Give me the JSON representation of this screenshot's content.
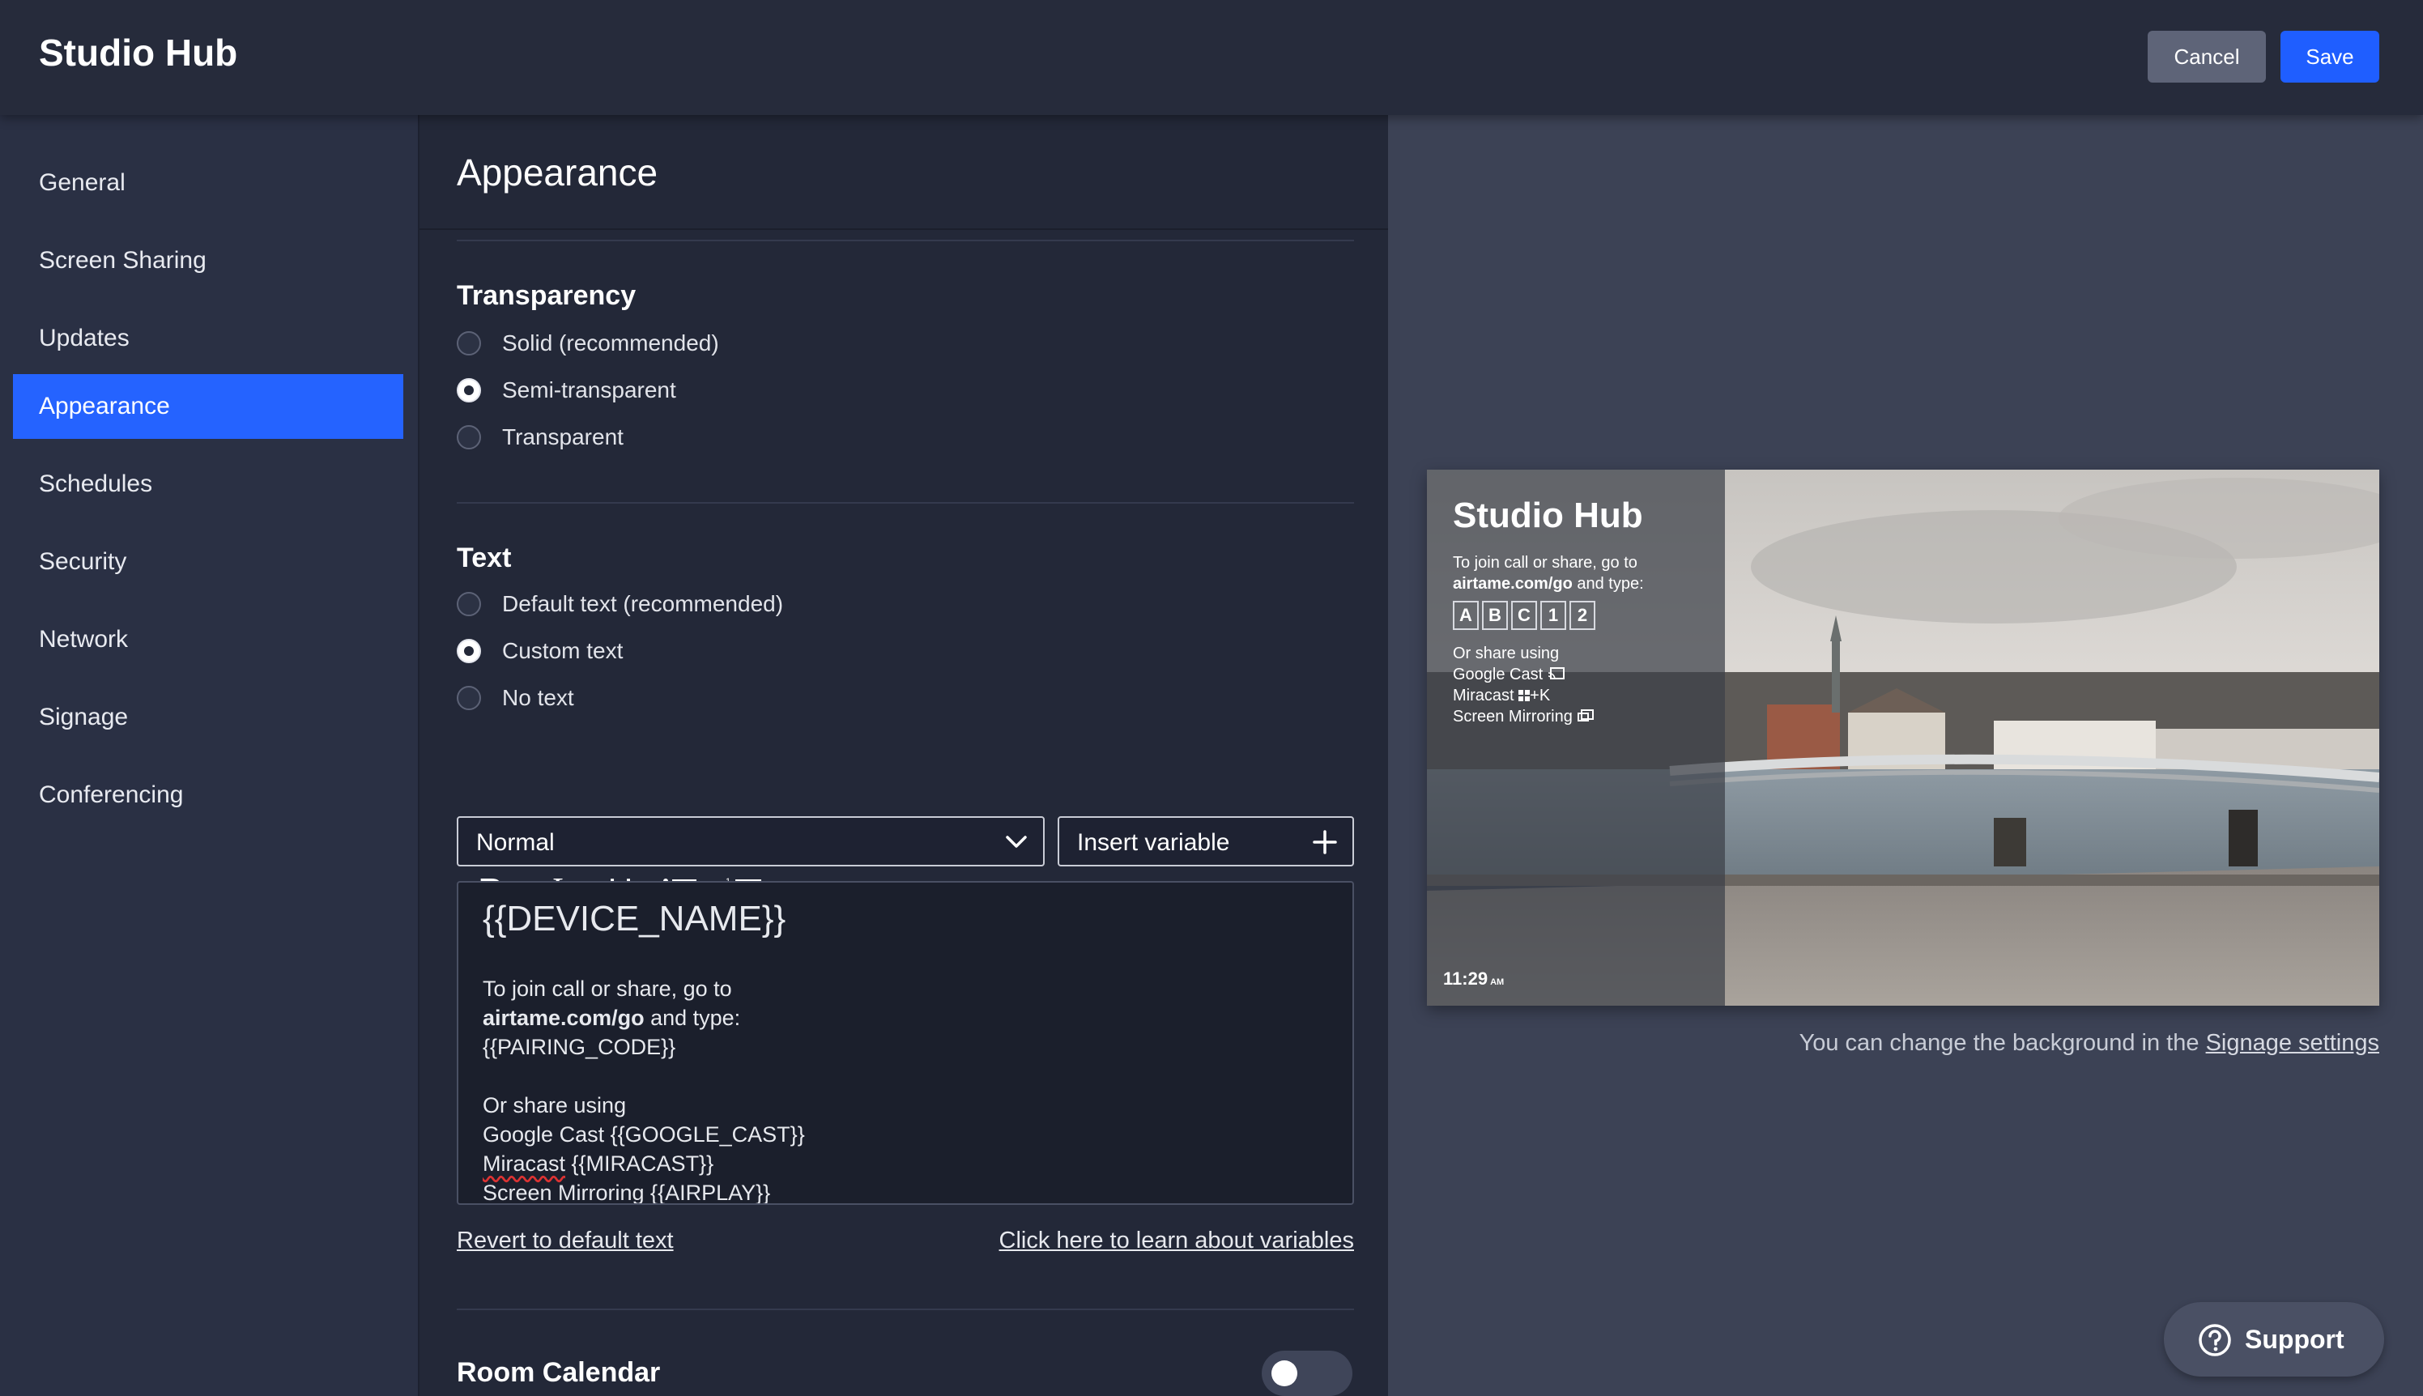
{
  "app": {
    "title": "Studio Hub"
  },
  "header": {
    "cancel_label": "Cancel",
    "save_label": "Save"
  },
  "sidebar": {
    "items": [
      {
        "label": "General"
      },
      {
        "label": "Screen Sharing"
      },
      {
        "label": "Updates"
      },
      {
        "label": "Appearance",
        "active": true
      },
      {
        "label": "Schedules"
      },
      {
        "label": "Security"
      },
      {
        "label": "Network"
      },
      {
        "label": "Signage"
      },
      {
        "label": "Conferencing"
      }
    ]
  },
  "panel": {
    "title": "Appearance",
    "transparency": {
      "title": "Transparency",
      "options": [
        "Solid (recommended)",
        "Semi-transparent",
        "Transparent"
      ],
      "selected": "Semi-transparent"
    },
    "text": {
      "title": "Text",
      "options": [
        "Default text (recommended)",
        "Custom text",
        "No text"
      ],
      "selected": "Custom text"
    },
    "editor": {
      "format_select": "Normal",
      "insert_variable_label": "Insert variable",
      "content": {
        "heading": "{{DEVICE_NAME}}",
        "line1": "To join call or share, go to",
        "line2_bold": "airtame.com/go",
        "line2_rest": " and type:",
        "line3": "{{PAIRING_CODE}}",
        "line4": "Or share using",
        "line5": "Google Cast {{GOOGLE_CAST}}",
        "line6_a": "Miracast",
        "line6_b": " {{MIRACAST}}",
        "line7": "Screen Mirroring {{AIRPLAY}}"
      }
    },
    "revert_link": "Revert to default text",
    "learn_link": "Click here to learn about variables",
    "room_calendar": {
      "title": "Room Calendar",
      "enabled": false
    }
  },
  "preview": {
    "title": "Studio Hub",
    "join_line": "To join call or share, go to",
    "url": "airtame.com/go",
    "url_rest": " and type:",
    "code": [
      "A",
      "B",
      "C",
      "1",
      "2"
    ],
    "share_title": "Or share using",
    "google_cast": "Google Cast",
    "miracast": "Miracast",
    "miracast_key": "+K",
    "screen_mirroring": "Screen Mirroring",
    "time": "11:29",
    "ampm": "AM",
    "note_prefix": "You can change the background in the ",
    "note_link": "Signage settings"
  },
  "support": {
    "label": "Support"
  }
}
